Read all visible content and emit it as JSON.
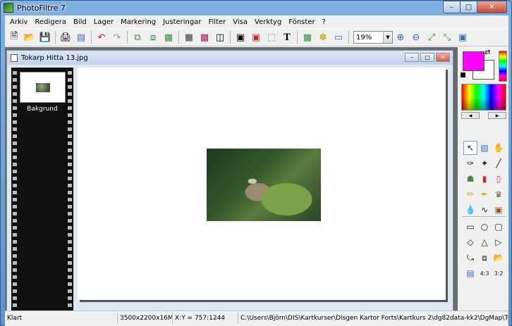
{
  "window": {
    "title": "PhotoFiltre 7"
  },
  "menu": [
    "Arkiv",
    "Redigera",
    "Bild",
    "Lager",
    "Markering",
    "Justeringar",
    "Filter",
    "Visa",
    "Verktyg",
    "Fönster",
    "?"
  ],
  "toolbar": {
    "zoom": "19%"
  },
  "document": {
    "title": "Tokarp Hitta 13.jpg",
    "layer_label": "Bakgrund"
  },
  "colors": {
    "foreground": "#ff00ff",
    "background": "#ffffff"
  },
  "status": {
    "state": "Klart",
    "image_info": "3500x2200x16M",
    "coords": "X:Y = 757:1244",
    "path": "C:\\Users\\Björn\\DIS\\Kartkurser\\Disgen Kartor Forts\\Kartkurs 2\\dg82data-kk2\\DgMap\\Tok"
  }
}
